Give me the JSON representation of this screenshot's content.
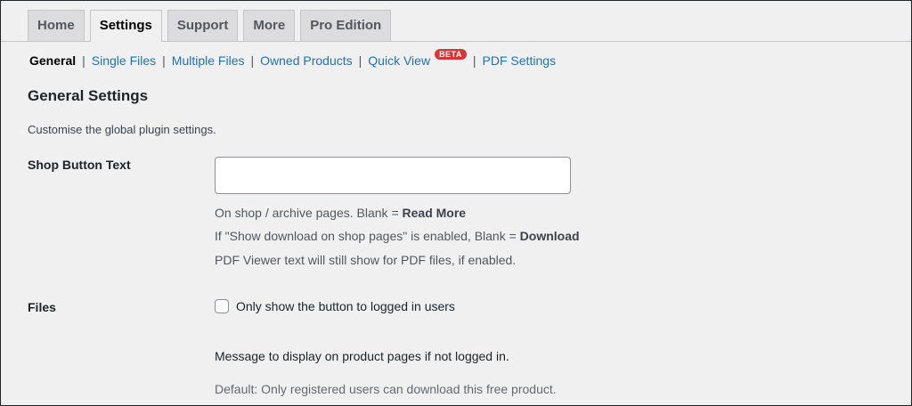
{
  "tabs": [
    {
      "label": "Home",
      "active": false
    },
    {
      "label": "Settings",
      "active": true
    },
    {
      "label": "Support",
      "active": false
    },
    {
      "label": "More",
      "active": false
    },
    {
      "label": "Pro Edition",
      "active": false
    }
  ],
  "subnav": {
    "general": "General",
    "single_files": "Single Files",
    "multiple_files": "Multiple Files",
    "owned_products": "Owned Products",
    "quick_view": "Quick View",
    "beta_badge": "BETA",
    "pdf_settings": "PDF Settings",
    "separator": "|"
  },
  "section": {
    "title": "General Settings",
    "description": "Customise the global plugin settings."
  },
  "shop_button": {
    "label": "Shop Button Text",
    "value": "",
    "help_1_prefix": "On shop / archive pages. Blank = ",
    "help_1_bold": "Read More",
    "help_2_prefix": "If \"Show download on shop pages\" is enabled, Blank = ",
    "help_2_bold": "Download",
    "help_3": "PDF Viewer text will still show for PDF files, if enabled."
  },
  "files": {
    "label": "Files",
    "checkbox_label": "Only show the button to logged in users",
    "checked": false,
    "message_label": "Message to display on product pages if not logged in.",
    "default_note": "Default: Only registered users can download this free product."
  },
  "colors": {
    "background": "#f0f0f1",
    "link": "#2271b1",
    "badge": "#d63638"
  }
}
